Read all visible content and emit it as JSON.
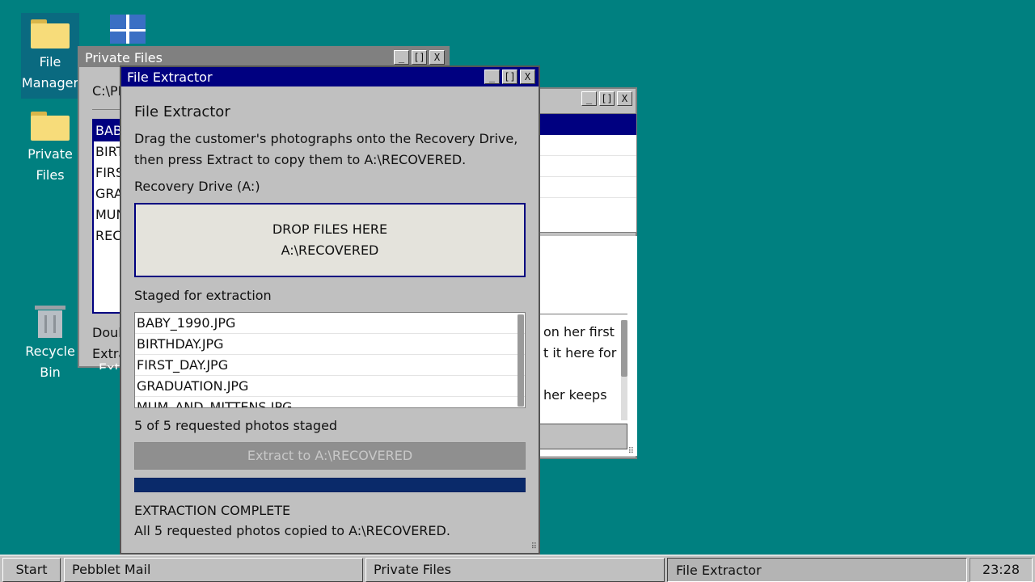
{
  "desktop": {
    "icons": [
      {
        "label_line1": "File",
        "label_line2": "Manager"
      },
      {
        "label_line1": "Private",
        "label_line2": "Files"
      },
      {
        "label_line1": "Recycle",
        "label_line2": "Bin"
      }
    ]
  },
  "private_window": {
    "title": "Private Files",
    "path": "C:\\PI",
    "files": [
      "BAB",
      "BIRT",
      "FIRS",
      "GRA",
      "MUN",
      "RECI"
    ],
    "footer_line1": "Doul",
    "footer_line2": "Extra",
    "footer_line3": "Extr"
  },
  "mail_window": {
    "snippet_line1": "on her first",
    "snippet_line2": "t it here for",
    "snippet_line3": "her keeps"
  },
  "extractor": {
    "title": "File Extractor",
    "heading": "File Extractor",
    "instructions_line1": "Drag the customer's photographs onto the Recovery Drive,",
    "instructions_line2": "then press Extract to copy them to A:\\RECOVERED.",
    "drive_label": "Recovery Drive (A:)",
    "drop_line1": "DROP FILES HERE",
    "drop_line2": "A:\\RECOVERED",
    "staged_label": "Staged for extraction",
    "staged_files": [
      "BABY_1990.JPG",
      "BIRTHDAY.JPG",
      "FIRST_DAY.JPG",
      "GRADUATION.JPG",
      "MUM_AND_MITTENS.JPG"
    ],
    "staged_count": "5 of 5 requested photos staged",
    "extract_button": "Extract to A:\\RECOVERED",
    "progress": 1.0,
    "status_title": "EXTRACTION COMPLETE",
    "status_message": "All 5 requested photos copied to A:\\RECOVERED."
  },
  "window_buttons": {
    "minimize": "_",
    "maximize": "[]",
    "close": "X"
  },
  "taskbar": {
    "start": "Start",
    "tasks": [
      "Pebblet Mail",
      "Private Files",
      "File Extractor"
    ],
    "clock": "23:28"
  }
}
